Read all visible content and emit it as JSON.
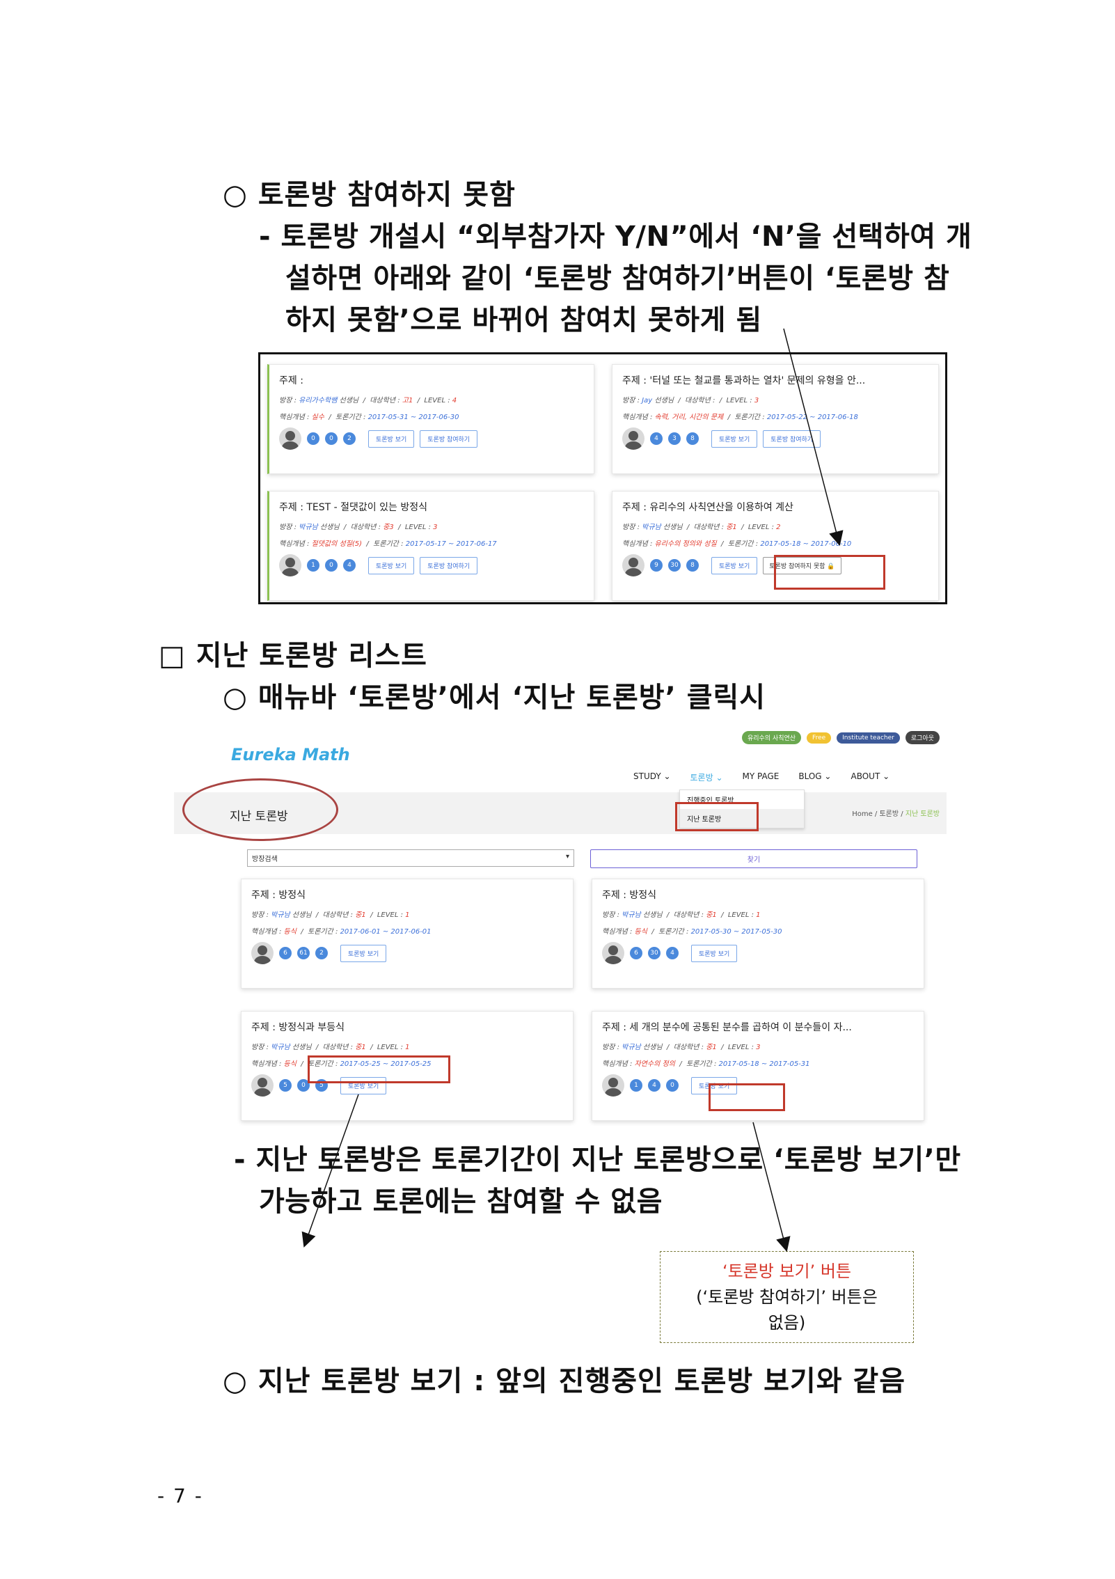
{
  "section1": {
    "heading": "○ 토론방 참여하지 못함",
    "lines": [
      "- 토론방 개설시 “외부참가자 Y/N”에서 ‘N’을 선택하여 개",
      "설하면 아래와 같이 ‘토론방 참여하기’버튼이 ‘토론방 참",
      "하지 못함’으로 바뀌어 참여치 못하게 됨"
    ]
  },
  "shot1": {
    "cards": [
      {
        "title": "주제 :",
        "host_label": "방장 : ",
        "host": "유리가수학쌤",
        "host_suffix": " 선생님",
        "grade_label": "대상학년 : ",
        "grade": "고1",
        "level_label": "LEVEL : ",
        "level": "4",
        "concept_label": "핵심개념 : ",
        "concept": "실수",
        "period_label": "토론기간 : ",
        "period": "2017-05-31 ~ 2017-06-30",
        "counts": [
          "0",
          "0",
          "2"
        ],
        "btn_view": "토론방 보기",
        "btn_join": "토론방 참여하기"
      },
      {
        "title": "주제 : '터널 또는 철교를 통과하는 열차' 문제의 유형을 안...",
        "host_label": "방장 : ",
        "host": "Jay",
        "host_suffix": " 선생님",
        "grade_label": "대상학년 : ",
        "grade": "",
        "level_label": "LEVEL : ",
        "level": "3",
        "concept_label": "핵심개념 : ",
        "concept": "속력, 거리, 시간의 문제",
        "period_label": "토론기간 : ",
        "period": "2017-05-22 ~ 2017-06-18",
        "counts": [
          "4",
          "3",
          "8"
        ],
        "btn_view": "토론방 보기",
        "btn_join": "토론방 참여하기"
      },
      {
        "title": "주제 : TEST - 절댓값이 있는 방정식",
        "host_label": "방장 : ",
        "host": "박규남",
        "host_suffix": " 선생님",
        "grade_label": "대상학년 : ",
        "grade": "중3",
        "level_label": "LEVEL : ",
        "level": "3",
        "concept_label": "핵심개념 : ",
        "concept": "절댓값의 성질(5)",
        "period_label": "토론기간 : ",
        "period": "2017-05-17 ~ 2017-06-17",
        "counts": [
          "1",
          "0",
          "4"
        ],
        "btn_view": "토론방 보기",
        "btn_join": "토론방 참여하기"
      },
      {
        "title": "주제 : 유리수의 사칙연산을 이용하여 계산",
        "host_label": "방장 : ",
        "host": "박규남",
        "host_suffix": " 선생님",
        "grade_label": "대상학년 : ",
        "grade": "중1",
        "level_label": "LEVEL : ",
        "level": "2",
        "concept_label": "핵심개념 : ",
        "concept": "유리수의 정의와 성질",
        "period_label": "토론기간 : ",
        "period": "2017-05-18 ~ 2017-06-10",
        "counts": [
          "9",
          "30",
          "8"
        ],
        "btn_view": "토론방 보기",
        "btn_join": "토론방 참여하지 못함"
      }
    ]
  },
  "section2": {
    "heading": "□ 지난 토론방 리스트",
    "sub": "○ 매뉴바 ‘토론방’에서 ‘지난 토론방’ 클릭시"
  },
  "shot2": {
    "topbar": {
      "course": "유리수의 사칙연산",
      "free": "Free",
      "institute": "Institute teacher",
      "logout": "로그아웃"
    },
    "logo": "Eureka Math",
    "nav": [
      "STUDY ⌄",
      "토론방 ⌄",
      "MY PAGE",
      "BLOG ⌄",
      "ABOUT ⌄"
    ],
    "dropdown": [
      "진행중인 토론방",
      "지난 토론방"
    ],
    "page_title": "지난 토론방",
    "breadcrumb": {
      "home": "Home",
      "sep": " / ",
      "mid": "토론방",
      "current": "지난 토론방"
    },
    "select": "방장검색",
    "search": "찾기",
    "cards": [
      {
        "title": "주제 : 방정식",
        "host_label": "방장 : ",
        "host": "박규남",
        "host_suffix": " 선생님",
        "grade_label": "대상학년 : ",
        "grade": "중1",
        "level_label": "LEVEL : ",
        "level": "1",
        "concept_label": "핵심개념 : ",
        "concept": "등식",
        "period_label": "토론기간 : ",
        "period": "2017-06-01 ~ 2017-06-01",
        "counts": [
          "6",
          "61",
          "2"
        ],
        "btn_view": "토론방 보기"
      },
      {
        "title": "주제 : 방정식",
        "host_label": "방장 : ",
        "host": "박규남",
        "host_suffix": " 선생님",
        "grade_label": "대상학년 : ",
        "grade": "중1",
        "level_label": "LEVEL : ",
        "level": "1",
        "concept_label": "핵심개념 : ",
        "concept": "등식",
        "period_label": "토론기간 : ",
        "period": "2017-05-30 ~ 2017-05-30",
        "counts": [
          "6",
          "30",
          "4"
        ],
        "btn_view": "토론방 보기"
      },
      {
        "title": "주제 : 방정식과 부등식",
        "host_label": "방장 : ",
        "host": "박규남",
        "host_suffix": " 선생님",
        "grade_label": "대상학년 : ",
        "grade": "중1",
        "level_label": "LEVEL : ",
        "level": "1",
        "concept_label": "핵심개념 : ",
        "concept": "등식",
        "period_label": "토론기간 : ",
        "period": "2017-05-25 ~ 2017-05-25",
        "counts": [
          "5",
          "0",
          "5"
        ],
        "btn_view": "토론방 보기"
      },
      {
        "title": "주제 : 세 개의 분수에 공통된 분수를 곱하여 이 분수들이 자...",
        "host_label": "방장 : ",
        "host": "박규남",
        "host_suffix": " 선생님",
        "grade_label": "대상학년 : ",
        "grade": "중1",
        "level_label": "LEVEL : ",
        "level": "3",
        "concept_label": "핵심개념 : ",
        "concept": "자연수의 정의",
        "period_label": "토론기간 : ",
        "period": "2017-05-18 ~ 2017-05-31",
        "counts": [
          "1",
          "4",
          "0"
        ],
        "btn_view": "토론방 보기"
      }
    ]
  },
  "note_lines": [
    "- 지난 토론방은 토론기간이 지난 토론방으로 ‘토론방 보기’만",
    "가능하고 토론에는 참여할 수 없음"
  ],
  "callout": {
    "line1": "‘토론방 보기’ 버튼",
    "line2": "(‘토론방 참여하기’ 버튼은",
    "line3": "없음)"
  },
  "section3": {
    "heading": "○ 지난 토론방 보기 : 앞의 진행중인 토론방 보기와 같음"
  },
  "page_number": "- 7 -",
  "colors": {
    "accent_green": "#8cc152",
    "link_blue": "#3b6fd8",
    "highlight_red": "#c0392b",
    "logo_blue": "#3aa9e0"
  }
}
